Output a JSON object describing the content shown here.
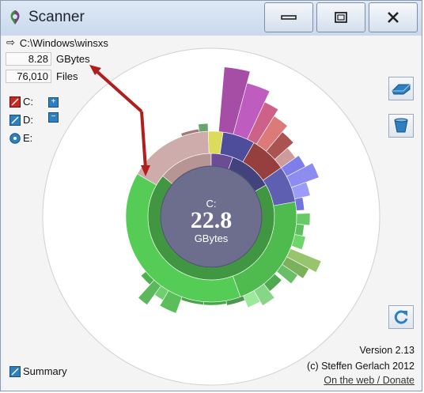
{
  "window": {
    "title": "Scanner"
  },
  "path": {
    "text": "C:\\Windows\\winsxs"
  },
  "stats": {
    "size_value": "8.28",
    "size_unit": "GBytes",
    "files_value": "76,010",
    "files_unit": "Files"
  },
  "drives": [
    {
      "label": "C:"
    },
    {
      "label": "D:"
    },
    {
      "label": "E:"
    }
  ],
  "center": {
    "drive": "C:",
    "size": "22.8",
    "unit": "GBytes"
  },
  "summary": {
    "label": "Summary"
  },
  "footer": {
    "version": "Version 2.13",
    "copyright": "(c) Steffen Gerlach 2012",
    "link": "On the web / Donate"
  },
  "colors": {
    "inner_ring": "#6d6e8e",
    "green_dark": "#2c8c2c",
    "green_light": "#4fd14f",
    "arrow": "#b01e1e"
  }
}
